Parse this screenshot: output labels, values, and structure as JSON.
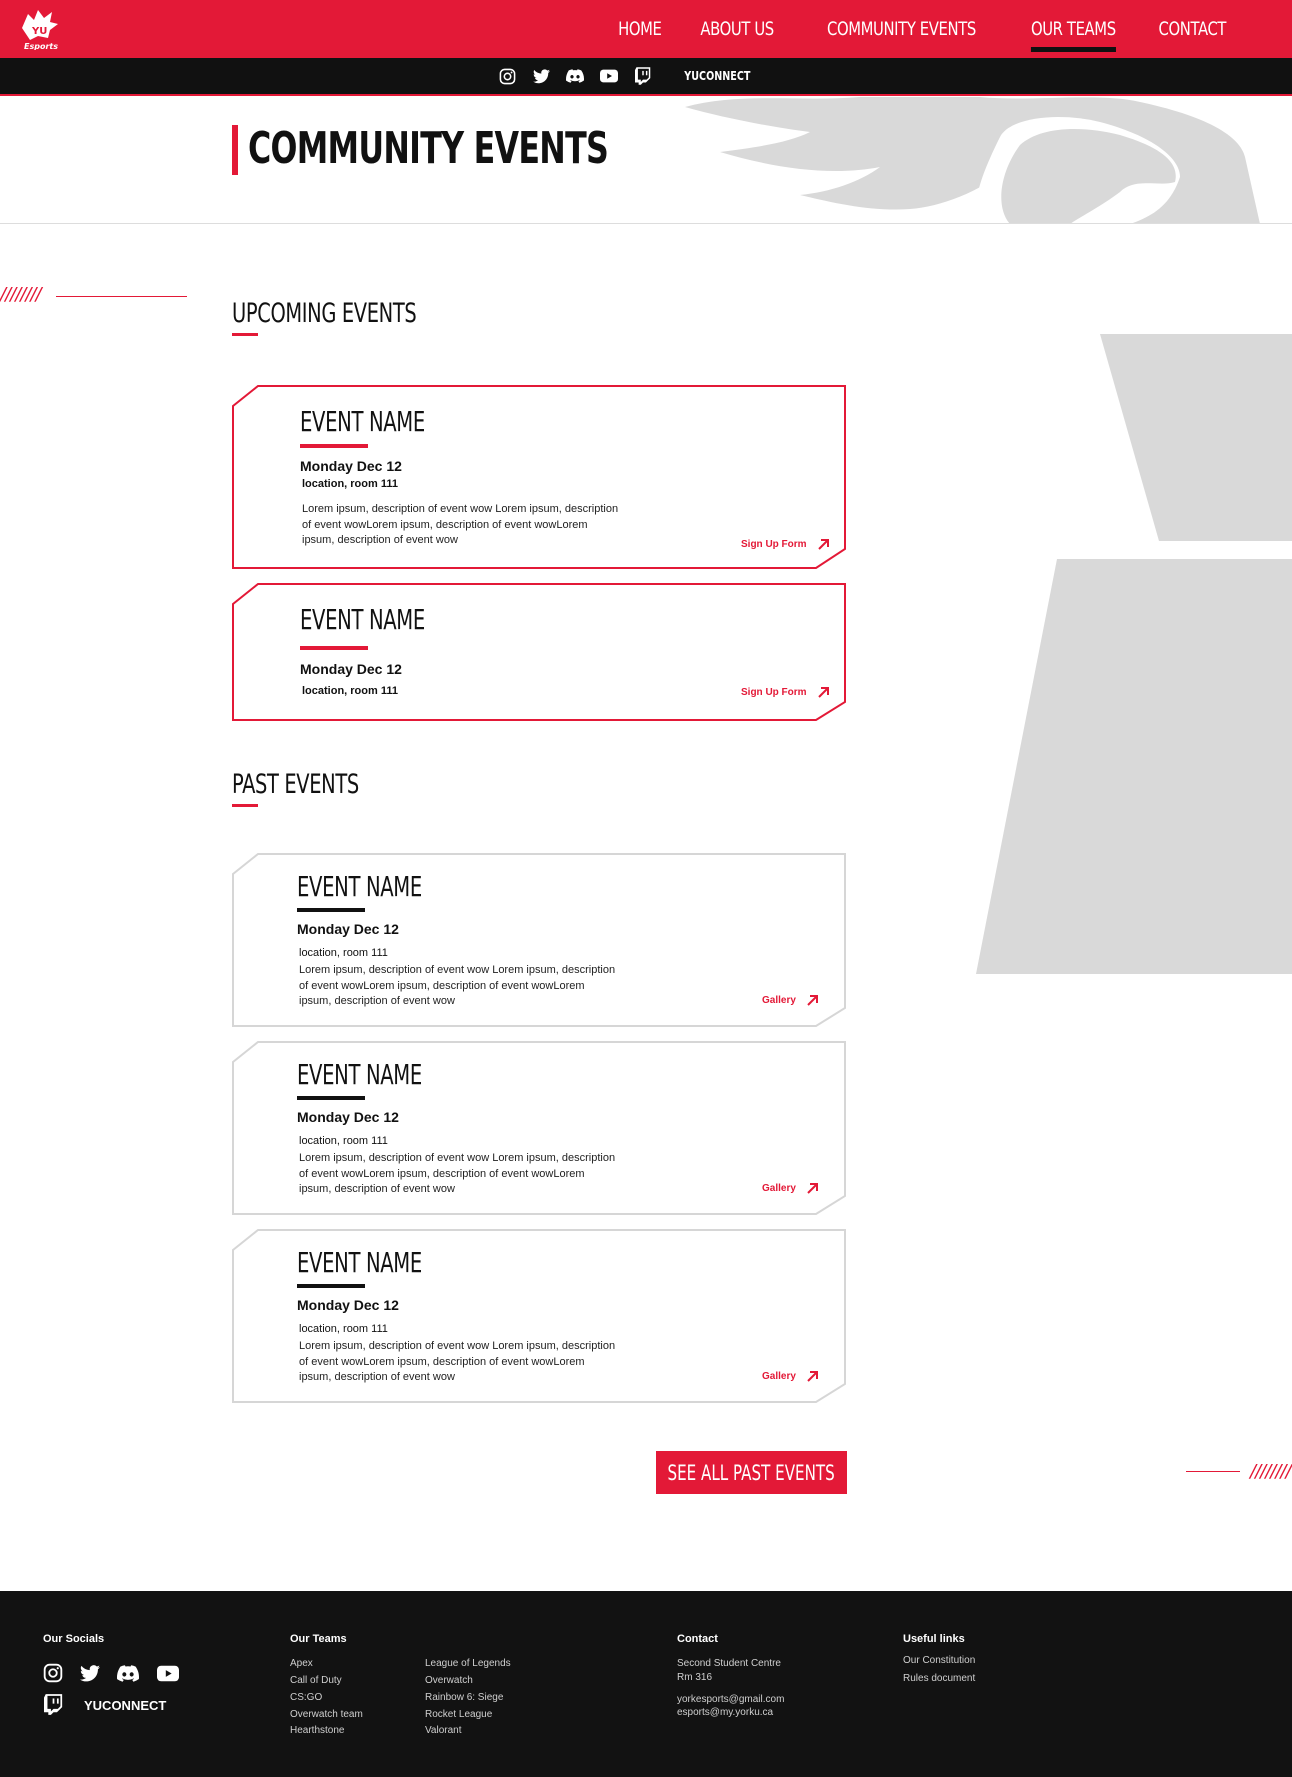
{
  "brand": {
    "logo_text": "Esports",
    "accent": "#e31937",
    "dark": "#111111",
    "gray": "#d9d9d9"
  },
  "nav": {
    "items": [
      "HOME",
      "ABOUT US",
      "COMMUNITY EVENTS",
      "OUR TEAMS",
      "CONTACT"
    ],
    "active": "OUR TEAMS"
  },
  "socialbar": {
    "icons": [
      "instagram-icon",
      "twitter-icon",
      "discord-icon",
      "youtube-icon",
      "twitch-icon"
    ],
    "yuconnect": "YUCONNECT"
  },
  "hero": {
    "title": "COMMUNITY EVENTS"
  },
  "decor": {
    "slashes": "////////"
  },
  "upcoming": {
    "title": "UPCOMING EVENTS",
    "events": [
      {
        "name": "EVENT NAME",
        "date": "Monday Dec 12",
        "location": "location, room 111",
        "description": "Lorem ipsum, description of event wow Lorem ipsum, description of event wowLorem ipsum, description of event wowLorem ipsum, description of event wow",
        "link": "Sign Up Form"
      },
      {
        "name": "EVENT NAME",
        "date": "Monday Dec 12",
        "location": "location, room 111",
        "link": "Sign Up Form"
      }
    ]
  },
  "past": {
    "title": "PAST EVENTS",
    "events": [
      {
        "name": "EVENT NAME",
        "date": "Monday Dec 12",
        "location": "location, room 111",
        "description": "Lorem ipsum, description of event wow Lorem ipsum, description of event wowLorem ipsum, description of event wowLorem ipsum, description of event wow",
        "link": "Gallery"
      },
      {
        "name": "EVENT NAME",
        "date": "Monday Dec 12",
        "location": "location, room 111",
        "description": "Lorem ipsum, description of event wow Lorem ipsum, description of event wowLorem ipsum, description of event wowLorem ipsum, description of event wow",
        "link": "Gallery"
      },
      {
        "name": "EVENT NAME",
        "date": "Monday Dec 12",
        "location": "location, room 111",
        "description": "Lorem ipsum, description of event wow Lorem ipsum, description of event wowLorem ipsum, description of event wowLorem ipsum, description of event wow",
        "link": "Gallery"
      }
    ],
    "cta": "SEE ALL PAST EVENTS"
  },
  "footer": {
    "socials_title": "Our Socials",
    "yuconnect": "YUCONNECT",
    "teams_title": "Our Teams",
    "teams_col1": [
      "Apex",
      "Call of Duty",
      "CS:GO",
      "Overwatch team",
      "Hearthstone"
    ],
    "teams_col2": [
      "League of Legends",
      "Overwatch",
      "Rainbow 6: Siege",
      "Rocket League",
      "Valorant"
    ],
    "contact_title": "Contact",
    "contact_lines": [
      "Second Student Centre",
      "Rm 316",
      "yorkesports@gmail.com",
      "esports@my.yorku.ca"
    ],
    "links_title": "Useful links",
    "links": [
      "Our Constitution",
      "Rules document"
    ]
  }
}
